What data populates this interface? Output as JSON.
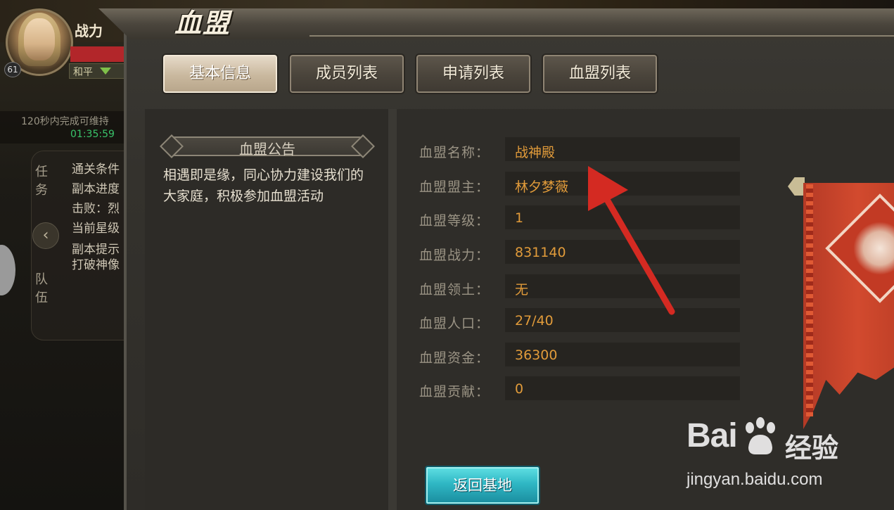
{
  "hud": {
    "power_label": "战力",
    "level": "61",
    "mode": "和平",
    "timer_hint": "120秒内完成可维持",
    "timer_value": "01:35:59",
    "task_tab": "任务",
    "team_tab": "队伍",
    "collapse_icon": "‹",
    "task_lines": [
      "通关条件",
      "副本进度",
      "击败：烈",
      "当前星级",
      "副本提示",
      "打破神像"
    ]
  },
  "panel": {
    "title": "血盟",
    "tabs": [
      {
        "label": "基本信息",
        "active": true
      },
      {
        "label": "成员列表",
        "active": false
      },
      {
        "label": "申请列表",
        "active": false
      },
      {
        "label": "血盟列表",
        "active": false
      }
    ],
    "notice": {
      "title": "血盟公告",
      "body": "相遇即是缘，同心协力建设我们的大家庭，积极参加血盟活动"
    },
    "info": [
      {
        "label": "血盟名称：",
        "value": "战神殿"
      },
      {
        "label": "血盟盟主：",
        "value": "林夕梦薇"
      },
      {
        "label": "血盟等级：",
        "value": "1"
      },
      {
        "label": "血盟战力：",
        "value": "831140"
      },
      {
        "label": "血盟领土：",
        "value": "无"
      },
      {
        "label": "血盟人口：",
        "value": "27/40"
      },
      {
        "label": "血盟资金：",
        "value": "36300"
      },
      {
        "label": "血盟贡献：",
        "value": "0"
      }
    ],
    "return_button": "返回基地"
  },
  "colors": {
    "accent_value": "#e19b3a",
    "return_button": "#2fb7c4",
    "banner": "#d24a2e",
    "annotation_arrow": "#d42a22"
  },
  "watermark": {
    "logo_left": "Bai",
    "logo_right": "经验",
    "url": "jingyan.baidu.com"
  }
}
